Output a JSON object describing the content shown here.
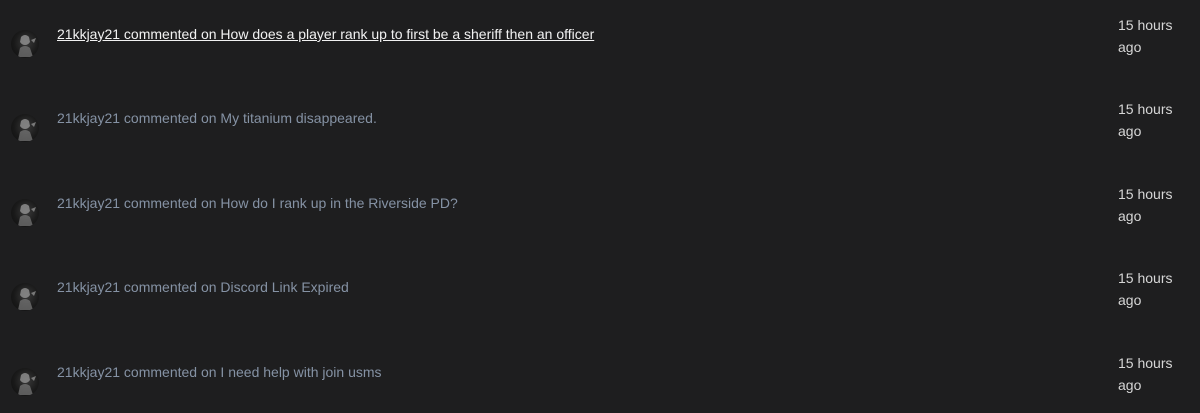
{
  "activity": {
    "items": [
      {
        "text": "21kkjay21 commented on How does a player rank up to first be a sheriff then an officer",
        "time_line1": "15 hours",
        "time_line2": "ago",
        "active": true
      },
      {
        "text": "21kkjay21 commented on My titanium disappeared.",
        "time_line1": "15 hours",
        "time_line2": "ago",
        "active": false
      },
      {
        "text": "21kkjay21 commented on How do I rank up in the Riverside PD?",
        "time_line1": "15 hours",
        "time_line2": "ago",
        "active": false
      },
      {
        "text": "21kkjay21 commented on Discord Link Expired",
        "time_line1": "15 hours",
        "time_line2": "ago",
        "active": false
      },
      {
        "text": "21kkjay21 commented on I need help with join usms",
        "time_line1": "15 hours",
        "time_line2": "ago",
        "active": false
      }
    ]
  },
  "icons": {
    "avatar": "user-avatar-icon"
  },
  "colors": {
    "background": "#1e1e1f",
    "link_muted": "#8592a4",
    "link_active": "#f2f2f2",
    "timestamp": "#d6d6d6"
  }
}
